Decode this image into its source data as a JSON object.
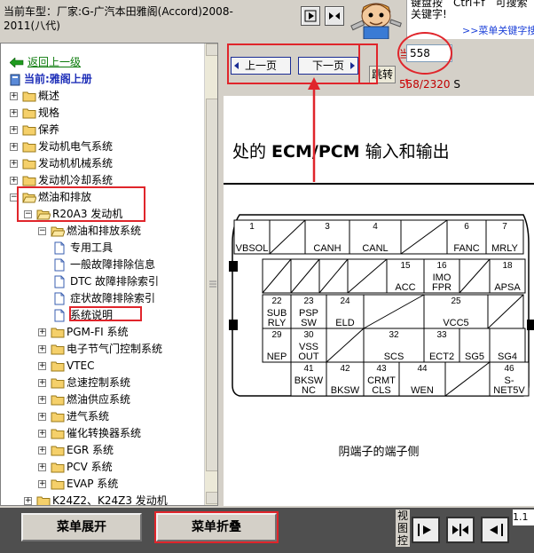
{
  "header": {
    "title": "当前车型：厂家:G-广汽本田雅阁(Accord)2008-2011(八代)",
    "tip_text": "键盘按　Ctrl+f　可搜索关键字!",
    "tip_link": ">>菜单关键字搜索<"
  },
  "tree": {
    "back_link": "返回上一级",
    "current_label": "当前:雅阁上册",
    "nodes": [
      {
        "label": "概述",
        "kind": "folder",
        "level": 0,
        "exp": "+"
      },
      {
        "label": "规格",
        "kind": "folder",
        "level": 0,
        "exp": "+"
      },
      {
        "label": "保养",
        "kind": "folder",
        "level": 0,
        "exp": "+"
      },
      {
        "label": "发动机电气系统",
        "kind": "folder",
        "level": 0,
        "exp": "+"
      },
      {
        "label": "发动机机械系统",
        "kind": "folder",
        "level": 0,
        "exp": "+"
      },
      {
        "label": "发动机冷却系统",
        "kind": "folder",
        "level": 0,
        "exp": "+"
      },
      {
        "label": "燃油和排放",
        "kind": "folder",
        "level": 0,
        "exp": "-"
      },
      {
        "label": "R20A3 发动机",
        "kind": "folder",
        "level": 1,
        "exp": "-"
      },
      {
        "label": "燃油和排放系统",
        "kind": "folder",
        "level": 2,
        "exp": "-"
      },
      {
        "label": "专用工具",
        "kind": "doc",
        "level": 3,
        "exp": ""
      },
      {
        "label": "一般故障排除信息",
        "kind": "doc",
        "level": 3,
        "exp": ""
      },
      {
        "label": "DTC 故障排除索引",
        "kind": "doc",
        "level": 3,
        "exp": ""
      },
      {
        "label": "症状故障排除索引",
        "kind": "doc",
        "level": 3,
        "exp": ""
      },
      {
        "label": "系统说明",
        "kind": "doc",
        "level": 3,
        "exp": ""
      },
      {
        "label": "PGM-FI 系统",
        "kind": "folder",
        "level": 2,
        "exp": "+"
      },
      {
        "label": "电子节气门控制系统",
        "kind": "folder",
        "level": 2,
        "exp": "+"
      },
      {
        "label": "VTEC",
        "kind": "folder",
        "level": 2,
        "exp": "+"
      },
      {
        "label": "怠速控制系统",
        "kind": "folder",
        "level": 2,
        "exp": "+"
      },
      {
        "label": "燃油供应系统",
        "kind": "folder",
        "level": 2,
        "exp": "+"
      },
      {
        "label": "进气系统",
        "kind": "folder",
        "level": 2,
        "exp": "+"
      },
      {
        "label": "催化转换器系统",
        "kind": "folder",
        "level": 2,
        "exp": "+"
      },
      {
        "label": "EGR 系统",
        "kind": "folder",
        "level": 2,
        "exp": "+"
      },
      {
        "label": "PCV 系统",
        "kind": "folder",
        "level": 2,
        "exp": "+"
      },
      {
        "label": "EVAP 系统",
        "kind": "folder",
        "level": 2,
        "exp": "+"
      },
      {
        "label": "K24Z2、K24Z3 发动机",
        "kind": "folder",
        "level": 1,
        "exp": "+"
      }
    ]
  },
  "pager": {
    "prev_label": "上一页",
    "next_label": "下一页",
    "current_label": "当前为",
    "page_value": "558",
    "jump_label": "跳转",
    "total_text": "558/2320",
    "total_suffix": "S"
  },
  "document": {
    "heading_prefix": "处的 ",
    "heading_bold": "ECM/PCM",
    "heading_suffix": " 输入和输出",
    "caption": "阴端子的端子侧",
    "terminals": [
      {
        "n": "1",
        "l": "VBSOL"
      },
      {
        "n": "",
        "l": ""
      },
      {
        "n": "3",
        "l": "CANH"
      },
      {
        "n": "4",
        "l": "CANL"
      },
      {
        "n": "",
        "l": ""
      },
      {
        "n": "6",
        "l": "FANC"
      },
      {
        "n": "7",
        "l": "MRLY"
      },
      {
        "n": "",
        "l": ""
      },
      {
        "n": "",
        "l": ""
      },
      {
        "n": "",
        "l": ""
      },
      {
        "n": "",
        "l": ""
      },
      {
        "n": "15",
        "l": "ACC"
      },
      {
        "n": "16",
        "l": "IMO FPR"
      },
      {
        "n": "",
        "l": ""
      },
      {
        "n": "18",
        "l": "APSA"
      },
      {
        "n": "22",
        "l": "SUB RLY"
      },
      {
        "n": "23",
        "l": "PSP SW"
      },
      {
        "n": "24",
        "l": "ELD"
      },
      {
        "n": "",
        "l": ""
      },
      {
        "n": "25",
        "l": "VCC5"
      },
      {
        "n": "",
        "l": ""
      },
      {
        "n": "29",
        "l": "NEP"
      },
      {
        "n": "30",
        "l": "VSS OUT"
      },
      {
        "n": "",
        "l": ""
      },
      {
        "n": "32",
        "l": "SCS"
      },
      {
        "n": "33",
        "l": "ECT2"
      },
      {
        "n": "",
        "l": "SG5"
      },
      {
        "n": "",
        "l": "SG4"
      },
      {
        "n": "",
        "l": ""
      },
      {
        "n": "41",
        "l": "BKSW NC"
      },
      {
        "n": "42",
        "l": "BKSW"
      },
      {
        "n": "43",
        "l": "CRMT CLS"
      },
      {
        "n": "44",
        "l": "WEN"
      },
      {
        "n": "",
        "l": ""
      },
      {
        "n": "46",
        "l": "S- NET5V"
      }
    ]
  },
  "footer": {
    "expand_label": "菜单展开",
    "collapse_label": "菜单折叠",
    "view_ctrl_label": "视图控",
    "status_right": "1.1"
  },
  "colors": {
    "annotation_red": "#e0252b",
    "page_count_red": "#c00000",
    "link_blue": "#1a3fd8",
    "footer_dark": "#4f4f4f"
  }
}
